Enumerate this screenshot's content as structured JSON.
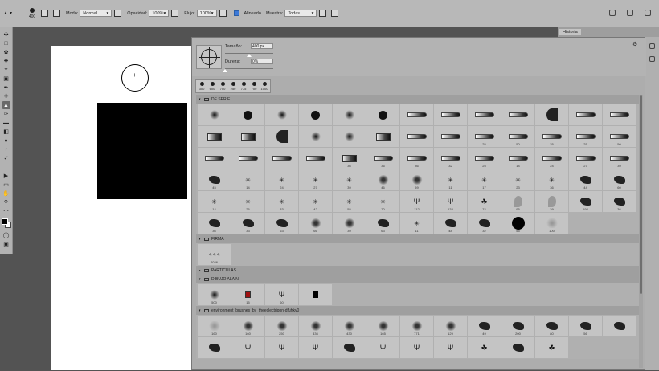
{
  "options": {
    "brush_size": "400",
    "mode_label": "Modo:",
    "mode_value": "Normal",
    "opacity_label": "Opacidad:",
    "opacity_value": "100%",
    "flow_label": "Flujo:",
    "flow_value": "100%",
    "aligned_label": "Alineado",
    "sample_label": "Muestra:",
    "sample_value": "Todas"
  },
  "history_tab": "Historia",
  "brush_panel": {
    "size_label": "Tamaño:",
    "size_value": "400 px",
    "hardness_label": "Dureza:",
    "hardness_value": "0%",
    "size_fraction": 0.5,
    "hardness_fraction": 0.0
  },
  "presets": [
    "300",
    "600",
    "750",
    "250",
    "775",
    "700",
    "1000"
  ],
  "groups": [
    {
      "name": "DE SERIE",
      "expanded": true,
      "brushes": [
        {
          "g": "soft",
          "n": ""
        },
        {
          "g": "hard",
          "n": ""
        },
        {
          "g": "soft",
          "n": ""
        },
        {
          "g": "hard",
          "n": ""
        },
        {
          "g": "soft",
          "n": ""
        },
        {
          "g": "hard",
          "n": ""
        },
        {
          "g": "pencil",
          "n": ""
        },
        {
          "g": "pencil",
          "n": ""
        },
        {
          "g": "pencil",
          "n": ""
        },
        {
          "g": "pencil",
          "n": ""
        },
        {
          "g": "fan",
          "n": ""
        },
        {
          "g": "pencil",
          "n": ""
        },
        {
          "g": "pencil",
          "n": ""
        },
        {
          "g": "flat",
          "n": ""
        },
        {
          "g": "flat",
          "n": ""
        },
        {
          "g": "fan",
          "n": ""
        },
        {
          "g": "soft",
          "n": ""
        },
        {
          "g": "soft",
          "n": ""
        },
        {
          "g": "flat",
          "n": ""
        },
        {
          "g": "pencil",
          "n": ""
        },
        {
          "g": "pencil",
          "n": ""
        },
        {
          "g": "pencil",
          "n": "25"
        },
        {
          "g": "pencil",
          "n": "50"
        },
        {
          "g": "pencil",
          "n": "25"
        },
        {
          "g": "pencil",
          "n": "25"
        },
        {
          "g": "pencil",
          "n": "50"
        },
        {
          "g": "pencil",
          "n": ""
        },
        {
          "g": "pencil",
          "n": ""
        },
        {
          "g": "pencil",
          "n": ""
        },
        {
          "g": "pencil",
          "n": ""
        },
        {
          "g": "flat",
          "n": "36"
        },
        {
          "g": "pencil",
          "n": "36"
        },
        {
          "g": "pencil",
          "n": "36"
        },
        {
          "g": "pencil",
          "n": "32"
        },
        {
          "g": "pencil",
          "n": "25"
        },
        {
          "g": "pencil",
          "n": "14"
        },
        {
          "g": "pencil",
          "n": "24"
        },
        {
          "g": "pencil",
          "n": "27"
        },
        {
          "g": "pencil",
          "n": "39"
        },
        {
          "g": "splat",
          "n": "45"
        },
        {
          "g": "star",
          "n": "14"
        },
        {
          "g": "star",
          "n": "24"
        },
        {
          "g": "star",
          "n": "27"
        },
        {
          "g": "star",
          "n": "39"
        },
        {
          "g": "fuzz",
          "n": "46"
        },
        {
          "g": "fuzz",
          "n": "59"
        },
        {
          "g": "star",
          "n": "11"
        },
        {
          "g": "star",
          "n": "17"
        },
        {
          "g": "star",
          "n": "23"
        },
        {
          "g": "star",
          "n": "36"
        },
        {
          "g": "splat",
          "n": "44"
        },
        {
          "g": "splat",
          "n": "60"
        },
        {
          "g": "star",
          "n": "14"
        },
        {
          "g": "star",
          "n": "26"
        },
        {
          "g": "star",
          "n": "33"
        },
        {
          "g": "star",
          "n": "42"
        },
        {
          "g": "star",
          "n": "55"
        },
        {
          "g": "star",
          "n": "70"
        },
        {
          "g": "grass",
          "n": "112"
        },
        {
          "g": "grass",
          "n": "134"
        },
        {
          "g": "leaf",
          "n": "74"
        },
        {
          "g": "leafgrey",
          "n": "95"
        },
        {
          "g": "leafgrey",
          "n": "29"
        },
        {
          "g": "splat",
          "n": "192"
        },
        {
          "g": "splat",
          "n": "36"
        },
        {
          "g": "splat",
          "n": "36"
        },
        {
          "g": "splat",
          "n": "33"
        },
        {
          "g": "splat",
          "n": "63"
        },
        {
          "g": "fuzz",
          "n": "66"
        },
        {
          "g": "fuzz",
          "n": "39"
        },
        {
          "g": "splat",
          "n": "63"
        },
        {
          "g": "star",
          "n": "11"
        },
        {
          "g": "splat",
          "n": "48"
        },
        {
          "g": "splat",
          "n": "32"
        },
        {
          "g": "blob",
          "n": "55"
        },
        {
          "g": "light",
          "n": "100"
        }
      ]
    },
    {
      "name": "FIRMA",
      "expanded": true,
      "brushes": [
        {
          "g": "sig",
          "n": "2026"
        }
      ]
    },
    {
      "name": "PARTICULAS",
      "expanded": false,
      "brushes": []
    },
    {
      "name": "DIBUJO ALAIN",
      "expanded": true,
      "brushes": [
        {
          "g": "soft",
          "n": "500"
        },
        {
          "g": "red",
          "n": "15"
        },
        {
          "g": "grass",
          "n": "60"
        },
        {
          "g": "black",
          "n": ""
        }
      ]
    },
    {
      "name": "environment_brushes_by_theeclectrigon-dfuhkv0",
      "expanded": true,
      "brushes": [
        {
          "g": "light",
          "n": "160"
        },
        {
          "g": "fuzz",
          "n": "160"
        },
        {
          "g": "fuzz",
          "n": "250"
        },
        {
          "g": "fuzz",
          "n": "436"
        },
        {
          "g": "fuzz",
          "n": "430"
        },
        {
          "g": "fuzz",
          "n": "165"
        },
        {
          "g": "fuzz",
          "n": "771"
        },
        {
          "g": "fuzz",
          "n": "129"
        },
        {
          "g": "splat",
          "n": "49"
        },
        {
          "g": "splat",
          "n": "200"
        },
        {
          "g": "splat",
          "n": "80"
        },
        {
          "g": "splat",
          "n": "56"
        },
        {
          "g": "splat",
          "n": ""
        },
        {
          "g": "splat",
          "n": ""
        },
        {
          "g": "grass",
          "n": ""
        },
        {
          "g": "grass",
          "n": ""
        },
        {
          "g": "grass",
          "n": ""
        },
        {
          "g": "splat",
          "n": ""
        },
        {
          "g": "grass",
          "n": ""
        },
        {
          "g": "grass",
          "n": ""
        },
        {
          "g": "grass",
          "n": ""
        },
        {
          "g": "leaf",
          "n": ""
        },
        {
          "g": "splat",
          "n": ""
        },
        {
          "g": "leaf",
          "n": ""
        }
      ]
    }
  ]
}
